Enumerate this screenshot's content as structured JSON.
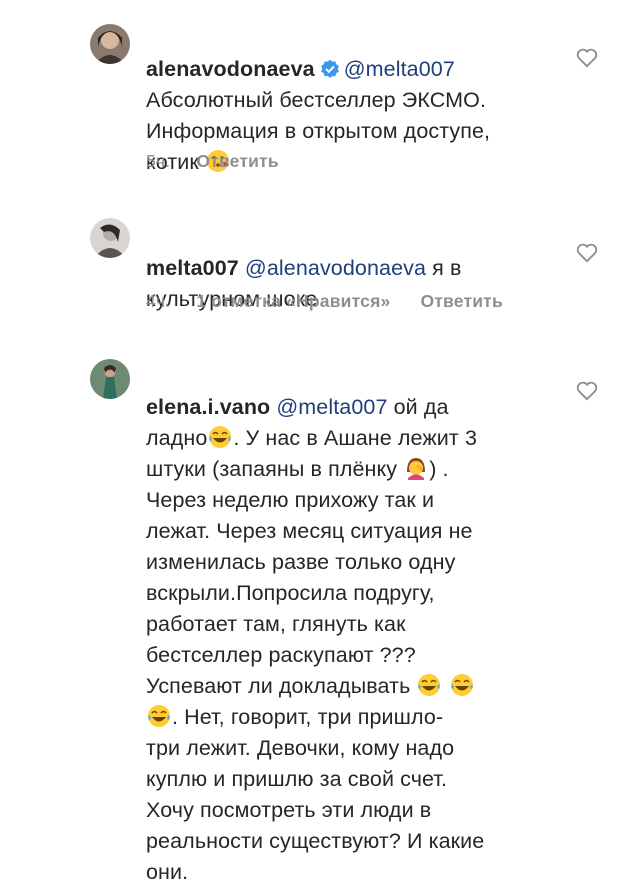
{
  "comments": [
    {
      "username": "alenavodonaeva",
      "verified": true,
      "mention": "@melta007",
      "text": "Абсолютный бестселлер ЭКСМО.\nИнформация в открытом доступе,\nкотик",
      "emoji": "kissing-heart-emoji",
      "time": "5ч.",
      "likes": "",
      "reply": "Ответить"
    },
    {
      "username": "melta007",
      "verified": false,
      "mention": "@alenavodonaeva",
      "text": "я в\nкультурном шоке",
      "time": "4ч.",
      "likes": "1 отметка «Нравится»",
      "reply": "Ответить"
    },
    {
      "username": "elena.i.vano",
      "verified": false,
      "mention": "@melta007",
      "text_parts": [
        "ой да\nладно",
        ". У нас в Ашане лежит 3\nштуки (запаяны в плёнку ",
        ") .\nЧерез неделю прихожу  так и\nлежат.  Через месяц ситуация не\nизменилась разве только  одну\nвскрыли.Попросила подругу,\nработает там, глянуть  как\nбестселлер раскупают ???\nУспевают ли докладывать ",
        ". Нет, говорит, три пришло-\nтри лежит.  Девочки, кому надо\nкуплю и пришлю за свой счет.\nХочу посмотреть эти люди в\nреальности существуют? И какие\nони."
      ],
      "emojis": [
        "tears-of-joy-emoji",
        "facepalm-woman-emoji",
        "tears-of-joy-emoji"
      ]
    }
  ],
  "icons": {
    "heart": "heart-outline-icon",
    "verified": "verified-badge-icon"
  },
  "colors": {
    "mention": "#1f3f7a",
    "meta": "#8e8e8e",
    "verified": "#3897f0"
  }
}
